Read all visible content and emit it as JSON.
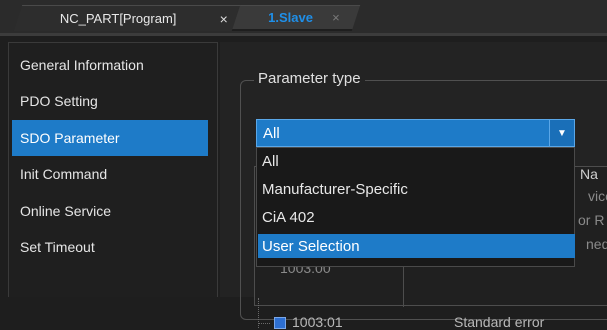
{
  "tabs": [
    {
      "label": "NC_PART[Program]",
      "close": "×"
    },
    {
      "label": "1.Slave",
      "close": "×"
    }
  ],
  "sidebar": {
    "items": [
      {
        "label": "General Information"
      },
      {
        "label": "PDO Setting"
      },
      {
        "label": "SDO Parameter"
      },
      {
        "label": "Init Command"
      },
      {
        "label": "Online Service"
      },
      {
        "label": "Set Timeout"
      }
    ],
    "active_index": 2
  },
  "parameter_type": {
    "title": "Parameter type",
    "selected": "All",
    "options": [
      "All",
      "Manufacturer-Specific",
      "CiA 402",
      "User Selection"
    ],
    "highlighted": "User Selection"
  },
  "table": {
    "header_name": "Na",
    "partial_right": [
      "vice",
      "or R",
      "ned"
    ],
    "partial_left": [
      "1003:00"
    ],
    "row": {
      "id": "1003:01",
      "description": "Standard error",
      "checked": true
    }
  },
  "colors": {
    "accent": "#1e7bc8",
    "background": "#1e1e1e",
    "slave_tab": "#1f8fe8"
  }
}
